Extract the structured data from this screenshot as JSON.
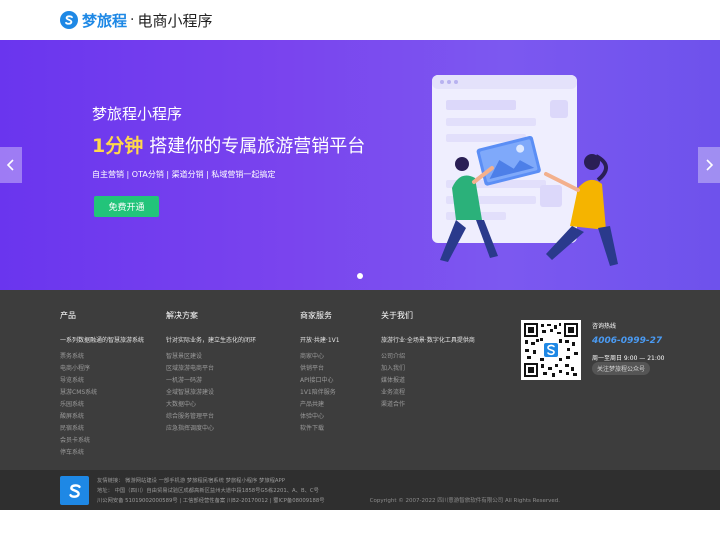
{
  "header": {
    "brand": "梦旅程",
    "separator": "·",
    "subtitle": "电商小程序"
  },
  "banner": {
    "title": "梦旅程小程序",
    "headline_highlight": "1分钟",
    "headline_rest": "搭建你的专属旅游营销平台",
    "features": "自主营销 | OTA分销 | 渠道分销 | 私域营销一起搞定",
    "cta": "免费开通",
    "slide_count": 1,
    "active_slide": 1
  },
  "footer": {
    "columns": [
      {
        "title": "产品",
        "lead": "一系列数据融通的智慧旅游系统",
        "items": [
          "票务系统",
          "电商小程序",
          "导览系统",
          "慧游CMS系统",
          "乐园系统",
          "酸屏系统",
          "民宿系统",
          "会员卡系统",
          "停车系统"
        ]
      },
      {
        "title": "解决方案",
        "lead": "针对实际业务，建立生态化的闭环",
        "items": [
          "智慧景区建设",
          "区域旅游电商平台",
          "一机游一码游",
          "全域智慧旅游建设",
          "大数据中心",
          "综合服务管理平台",
          "应急指挥调度中心"
        ]
      },
      {
        "title": "商家服务",
        "lead": "开放·共建·1V1",
        "items": [
          "商家中心",
          "供销平台",
          "API接口中心",
          "1V1陪伴服务",
          "产品共建",
          "体验中心",
          "软件下载"
        ]
      },
      {
        "title": "关于我们",
        "lead": "旅游行业·全场景·数字化工具提供商",
        "items": [
          "公司介绍",
          "加入我们",
          "媒体报道",
          "业务流程",
          "渠道合作"
        ]
      }
    ],
    "hotline_label": "咨询热线",
    "hotline_number": "4006-0999-27",
    "hours": "周一至周日 9:00 — 21:00",
    "follow_button": "关注梦旅程公众号"
  },
  "subfooter": {
    "links_line": "友情链接：   微游网站建设   一部手机游   梦旅程民宿系统   梦旅程小程序   梦旅程APP",
    "address_line": "地址：   中国（四川）自由贸易试验区成都高新区益州大道中段1858号G5栋2201、A、B、C号",
    "license_line": "川公网安备 51019002000589号 | 工信部经营性备案 川B2-20170012 | 蜀ICP备08009188号",
    "copyright": "Copyright © 2007-2022 四川意游智旅软件有限公司 All Rights Reserved."
  },
  "colors": {
    "brand_blue": "#1e88e5",
    "banner_purple": "#6a35ee",
    "cta_green": "#22c47a",
    "highlight_yellow": "#ffd84a",
    "hotline_blue": "#4a9af2"
  }
}
